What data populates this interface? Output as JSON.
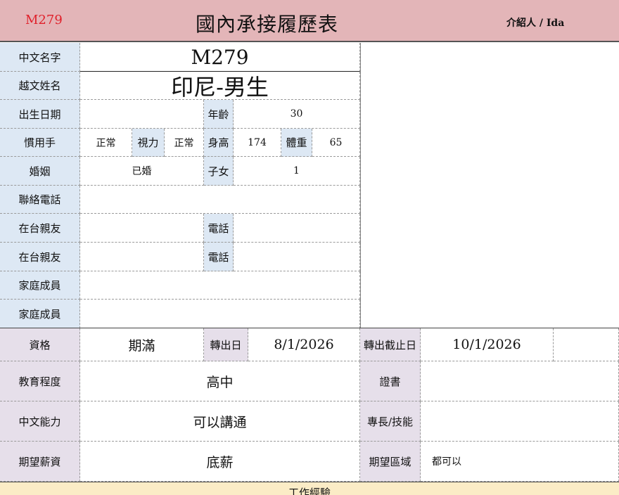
{
  "header": {
    "code": "M279",
    "title": "國內承接履歷表",
    "referrer": "介紹人 / Ida"
  },
  "profile": {
    "chinese_name_label": "中文名字",
    "chinese_name": "M279",
    "vietnamese_name_label": "越文姓名",
    "vietnamese_name": "印尼-男生",
    "birthdate_label": "出生日期",
    "birthdate": "",
    "age_label": "年齡",
    "age": "30",
    "handedness_label": "慣用手",
    "handedness": "正常",
    "vision_label": "視力",
    "vision": "正常",
    "height_label": "身高",
    "height": "174",
    "weight_label": "體重",
    "weight": "65",
    "marriage_label": "婚姻",
    "marriage": "已婚",
    "children_label": "子女",
    "children": "1",
    "contact_phone_label": "聯絡電話",
    "contact_phone": "",
    "relative1_label": "在台親友",
    "relative1": "",
    "relative1_phone_label": "電話",
    "relative1_phone": "",
    "relative2_label": "在台親友",
    "relative2": "",
    "relative2_phone_label": "電話",
    "relative2_phone": "",
    "family1_label": "家庭成員",
    "family1": "",
    "family2_label": "家庭成員",
    "family2": ""
  },
  "qualification": {
    "status_label": "資格",
    "status": "期滿",
    "transfer_date_label": "轉出日",
    "transfer_date": "8/1/2026",
    "transfer_deadline_label": "轉出截止日",
    "transfer_deadline": "10/1/2026",
    "education_label": "教育程度",
    "education": "高中",
    "certificate_label": "證書",
    "certificate": "",
    "chinese_ability_label": "中文能力",
    "chinese_ability": "可以講通",
    "skills_label": "專長/技能",
    "skills": "",
    "salary_label": "期望薪資",
    "salary": "底薪",
    "region_label": "期望區域",
    "region": "都可以"
  },
  "work_experience": {
    "title": "工作經驗"
  },
  "colors": {
    "header_bg": "#e3b5b8",
    "label_blue": "#dde8f4",
    "label_purple": "#e6dfea",
    "code_red": "#e0202a",
    "footer_yellow": "#fbecc6"
  }
}
